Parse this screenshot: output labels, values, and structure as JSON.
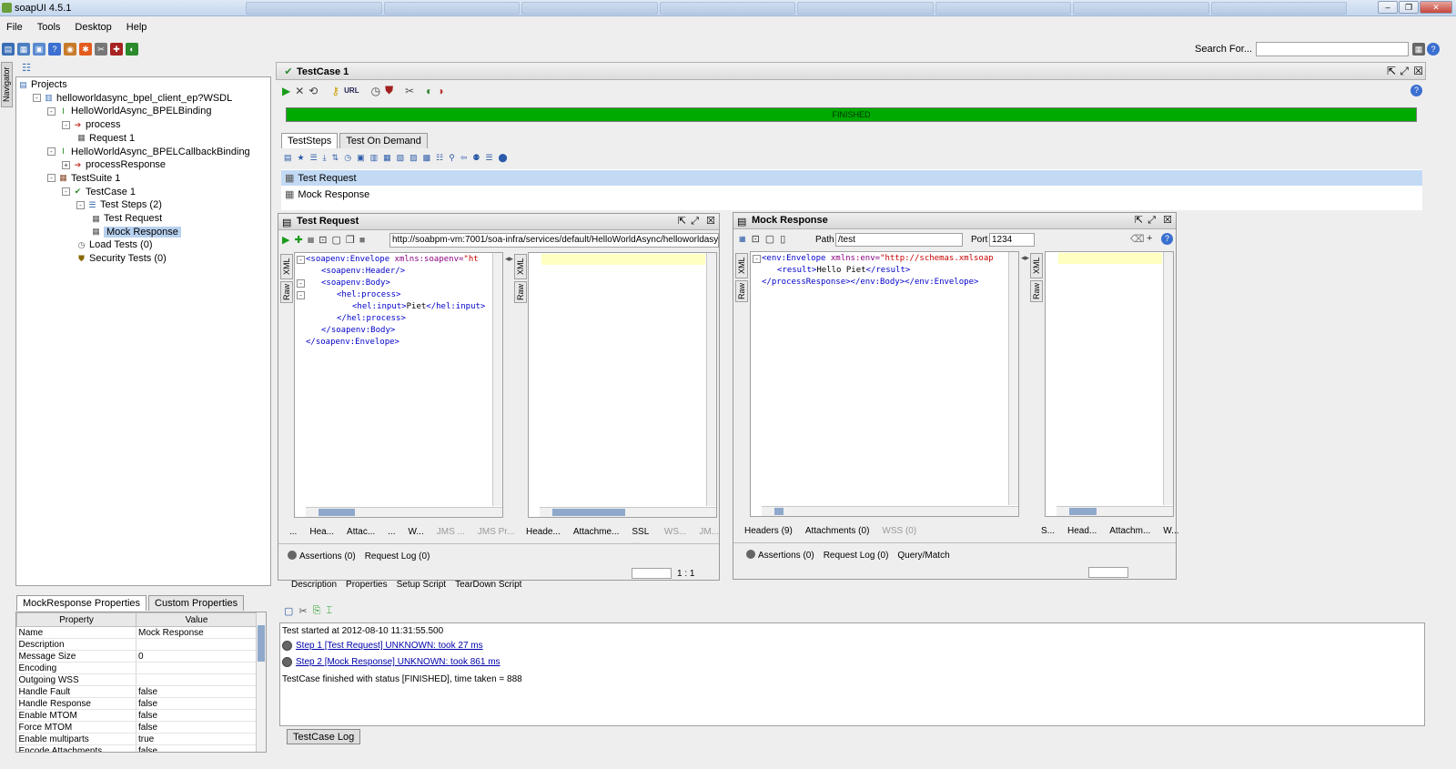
{
  "window": {
    "title": "soapUI 4.5.1"
  },
  "menu": [
    "File",
    "Tools",
    "Desktop",
    "Help"
  ],
  "search": {
    "label": "Search For..."
  },
  "navigator": {
    "label": "Navigator"
  },
  "tree": [
    {
      "label": "Projects",
      "indent": 0,
      "icon": "projects-icon",
      "exp": ""
    },
    {
      "label": "helloworldasync_bpel_client_ep?WSDL",
      "indent": 1,
      "icon": "project-icon",
      "exp": "-"
    },
    {
      "label": "HelloWorldAsync_BPELBinding",
      "indent": 2,
      "icon": "interface-icon",
      "exp": "-"
    },
    {
      "label": "process",
      "indent": 3,
      "icon": "operation-icon",
      "exp": "-"
    },
    {
      "label": "Request 1",
      "indent": 4,
      "icon": "request-icon",
      "exp": ""
    },
    {
      "label": "HelloWorldAsync_BPELCallbackBinding",
      "indent": 2,
      "icon": "interface-icon",
      "exp": "-"
    },
    {
      "label": "processResponse",
      "indent": 3,
      "icon": "operation-icon",
      "exp": "+"
    },
    {
      "label": "TestSuite 1",
      "indent": 2,
      "icon": "testsuite-icon",
      "exp": "-"
    },
    {
      "label": "TestCase 1",
      "indent": 3,
      "icon": "testcase-icon",
      "exp": "-"
    },
    {
      "label": "Test Steps (2)",
      "indent": 4,
      "icon": "teststeps-icon",
      "exp": "-"
    },
    {
      "label": "Test Request",
      "indent": 5,
      "icon": "request-icon",
      "exp": ""
    },
    {
      "label": "Mock Response",
      "indent": 5,
      "icon": "request-icon",
      "exp": "",
      "selected": true
    },
    {
      "label": "Load Tests (0)",
      "indent": 4,
      "icon": "loadtest-icon",
      "exp": ""
    },
    {
      "label": "Security Tests (0)",
      "indent": 4,
      "icon": "security-icon",
      "exp": ""
    }
  ],
  "props": {
    "tabs": [
      "MockResponse Properties",
      "Custom Properties"
    ],
    "headers": [
      "Property",
      "Value"
    ],
    "rows": [
      [
        "Name",
        "Mock Response"
      ],
      [
        "Description",
        ""
      ],
      [
        "Message Size",
        "0"
      ],
      [
        "Encoding",
        ""
      ],
      [
        "Outgoing WSS",
        ""
      ],
      [
        "Handle Fault",
        "false"
      ],
      [
        "Handle Response",
        "false"
      ],
      [
        "Enable MTOM",
        "false"
      ],
      [
        "Force MTOM",
        "false"
      ],
      [
        "Enable multiparts",
        "true"
      ],
      [
        "Encode Attachments",
        "false"
      ]
    ]
  },
  "testcase": {
    "title": "TestCase 1",
    "status": "FINISHED",
    "tabs": [
      "TestSteps",
      "Test On Demand"
    ],
    "steps": [
      "Test Request",
      "Mock Response"
    ],
    "bottom_tabs": [
      "Description",
      "Properties",
      "Setup Script",
      "TearDown Script"
    ],
    "log_tab": "TestCase Log"
  },
  "test_request": {
    "title": "Test Request",
    "url": "http://soabpm-vm:7001/soa-infra/services/default/HelloWorldAsync/helloworldasy",
    "xml_label": "XML",
    "raw_label": "Raw",
    "code": [
      {
        "indent": 0,
        "parts": [
          [
            "t",
            "<soapenv:Envelope "
          ],
          [
            "a",
            "xmlns:soapenv="
          ],
          [
            "v",
            "\"ht"
          ]
        ]
      },
      {
        "indent": 1,
        "parts": [
          [
            "t",
            "<soapenv:Header/>"
          ]
        ]
      },
      {
        "indent": 1,
        "parts": [
          [
            "t",
            "<soapenv:Body>"
          ]
        ]
      },
      {
        "indent": 2,
        "parts": [
          [
            "t",
            "<hel:process>"
          ]
        ]
      },
      {
        "indent": 3,
        "parts": [
          [
            "t",
            "<hel:input>"
          ],
          [
            "x",
            "Piet"
          ],
          [
            "t",
            "</hel:input>"
          ]
        ]
      },
      {
        "indent": 2,
        "parts": [
          [
            "t",
            "</hel:process>"
          ]
        ]
      },
      {
        "indent": 1,
        "parts": [
          [
            "t",
            "</soapenv:Body>"
          ]
        ]
      },
      {
        "indent": 0,
        "parts": [
          [
            "t",
            "</soapenv:Envelope>"
          ]
        ]
      }
    ],
    "req_tabs": [
      "...",
      "Hea...",
      "Attac...",
      "...",
      "W...",
      "JMS ...",
      "JMS Pr..."
    ],
    "req_tabs_dim": [
      false,
      false,
      false,
      false,
      false,
      true,
      true
    ],
    "resp_tabs": [
      "Heade...",
      "Attachme...",
      "SSL ...",
      "WS...",
      "JM..."
    ],
    "resp_tabs_dim": [
      false,
      false,
      false,
      true,
      true
    ],
    "bottom": [
      "Assertions (0)",
      "Request Log (0)"
    ],
    "position": "1 : 1"
  },
  "mock_response": {
    "title": "Mock Response",
    "path_label": "Path",
    "path": "/test",
    "port_label": "Port",
    "port": "1234",
    "xml_label": "XML",
    "raw_label": "Raw",
    "code": [
      {
        "indent": 0,
        "parts": [
          [
            "t",
            "<env:Envelope "
          ],
          [
            "a",
            "xmlns:env="
          ],
          [
            "v",
            "\"http://schemas.xmlsoap"
          ]
        ]
      },
      {
        "indent": 1,
        "parts": [
          [
            "t",
            "<result>"
          ],
          [
            "x",
            "Hello Piet"
          ],
          [
            "t",
            "</result>"
          ]
        ]
      },
      {
        "indent": 0,
        "parts": [
          [
            "t",
            "</processResponse></env:Body></env:Envelope>"
          ]
        ]
      }
    ],
    "req_tabs": [
      "Headers (9)",
      "Attachments (0)",
      "WSS (0)"
    ],
    "req_tabs_dim": [
      false,
      false,
      true
    ],
    "resp_tabs": [
      "S...",
      "Head...",
      "Attachm...",
      "W..."
    ],
    "resp_tabs_dim": [
      false,
      false,
      false,
      false
    ],
    "bottom": [
      "Assertions (0)",
      "Request Log (0)",
      "Query/Match"
    ]
  },
  "log": [
    {
      "text": "Test started at 2012-08-10 11:31:55.500",
      "link": false
    },
    {
      "text": "Step 1 [Test Request] UNKNOWN: took 27 ms",
      "link": true
    },
    {
      "text": "Step 2 [Mock Response] UNKNOWN: took 861 ms",
      "link": true
    },
    {
      "text": "TestCase finished with status [FINISHED], time taken = 888",
      "link": false
    }
  ]
}
